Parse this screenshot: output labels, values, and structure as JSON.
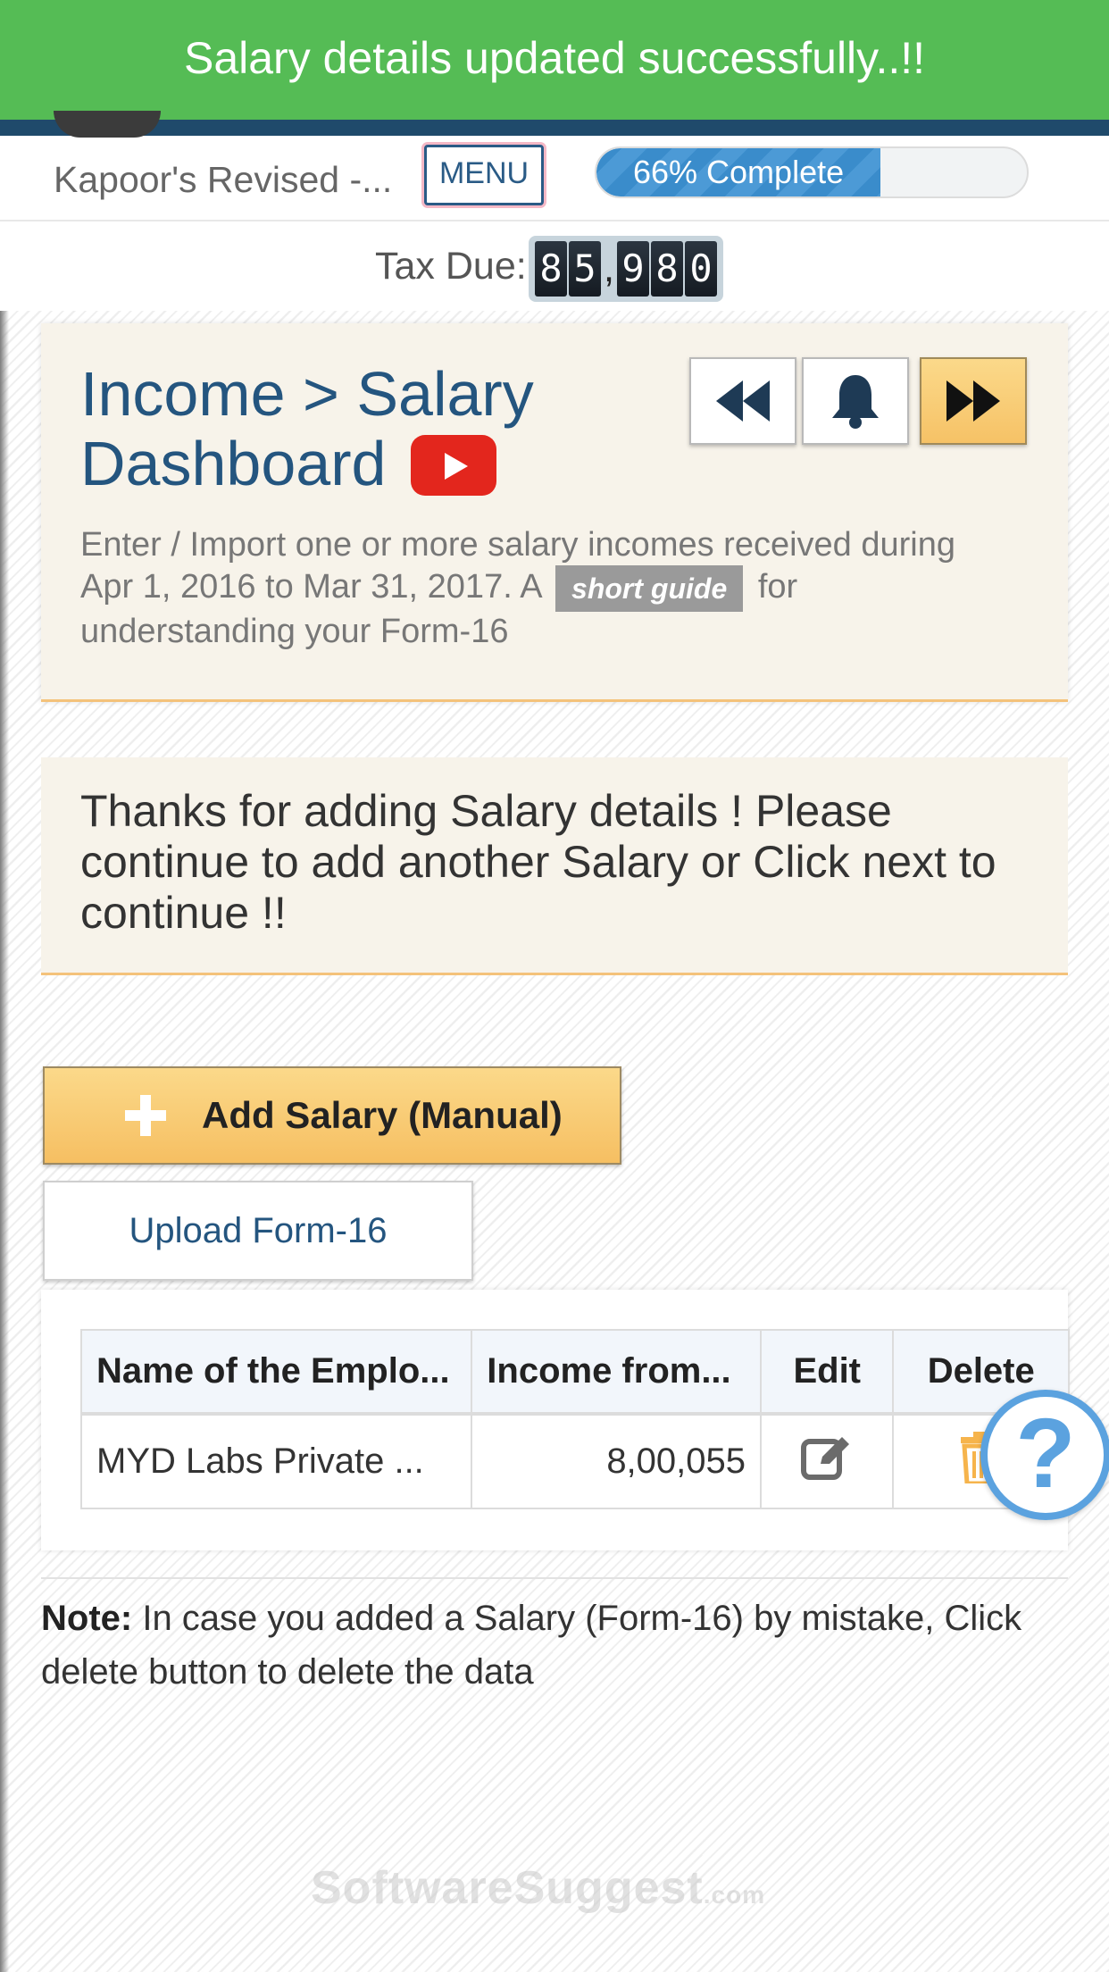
{
  "toast": {
    "message": "Salary details updated successfully..!!"
  },
  "header": {
    "document_name": "Kapoor's Revised -...",
    "menu_label": "MENU",
    "progress_label": "66% Complete",
    "progress_value": 0.66
  },
  "tax_due": {
    "label": "Tax Due:",
    "digits": [
      "8",
      "5",
      ",",
      "9",
      "8",
      "0"
    ]
  },
  "hero": {
    "title_line1": "Income > Salary",
    "title_line2": "Dashboard",
    "desc_before": "Enter / Import one or more salary incomes received during Apr 1, 2016 to Mar 31, 2017. A",
    "guide_label": "short guide",
    "desc_after": "for understanding your Form-16",
    "icons": {
      "prev": "double-chevron-left-icon",
      "bell": "bell-icon",
      "next": "double-chevron-right-icon",
      "video": "youtube-icon"
    }
  },
  "thanks": {
    "message": "Thanks for adding Salary details ! Please continue to add another Salary or Click next to continue !!"
  },
  "actions": {
    "add_salary_label": "Add Salary (Manual)",
    "upload_label": "Upload Form-16"
  },
  "table": {
    "headers": [
      "Name of the Emplo...",
      "Income from...",
      "Edit",
      "Delete"
    ],
    "rows": [
      {
        "employer": "MYD Labs Private ...",
        "income": "8,00,055"
      }
    ]
  },
  "help": {
    "symbol": "?"
  },
  "note": {
    "label": "Note:",
    "text": " In case you added a Salary (Form-16) by mistake, Click delete button to delete the data"
  },
  "watermark": {
    "brand": "SoftwareSuggest",
    "suffix": ".com"
  },
  "colors": {
    "toast_green": "#55bc55",
    "nav_blue": "#1f4a6b",
    "title_blue": "#24557f",
    "accent_orange": "#f6c266",
    "help_blue": "#5ba2df"
  }
}
